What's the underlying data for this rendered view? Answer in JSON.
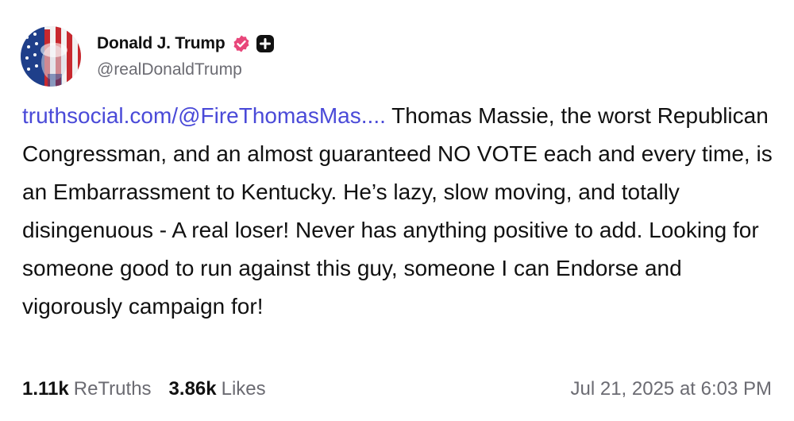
{
  "author": {
    "display_name": "Donald J. Trump",
    "handle": "@realDonaldTrump",
    "avatar_icon": "profile-avatar-flag",
    "verified_icon": "verified-badge-icon",
    "plus_icon": "plus-badge-icon",
    "verified_color": "#e8467a",
    "plus_color": "#111111"
  },
  "post": {
    "link_text": "truthsocial.com/@FireThomasMas....",
    "body": " Thomas Massie, the worst Republican Congressman, and an almost guaranteed NO VOTE each and every time, is an Embarrassment to Kentucky. He’s lazy, slow moving, and totally disingenuous - A real loser! Never has anything positive to add. Looking for someone good to run against this guy, someone I can Endorse and vigorously campaign for!",
    "link_color": "#4a4ad8"
  },
  "stats": {
    "retruths_count": "1.11k",
    "retruths_label": "ReTruths",
    "likes_count": "3.86k",
    "likes_label": "Likes"
  },
  "timestamp": "Jul 21, 2025 at 6:03 PM"
}
